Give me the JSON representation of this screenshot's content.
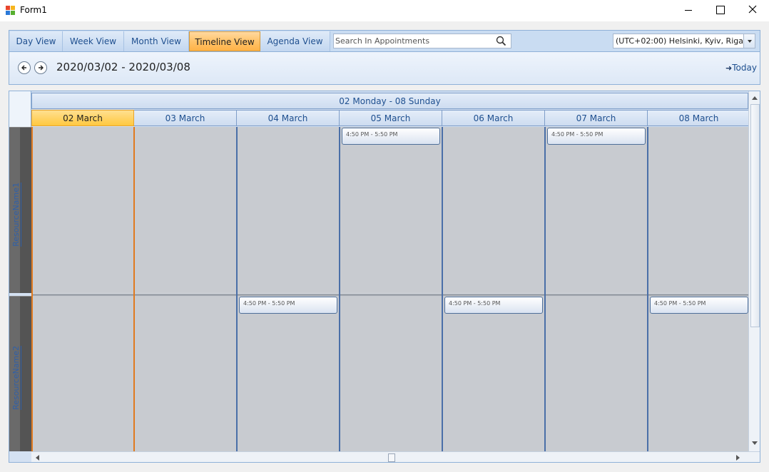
{
  "window": {
    "title": "Form1"
  },
  "tabs": [
    {
      "label": "Day View"
    },
    {
      "label": "Week View"
    },
    {
      "label": "Month View"
    },
    {
      "label": "Timeline View",
      "active": true
    },
    {
      "label": "Agenda View"
    }
  ],
  "search": {
    "placeholder": "Search In Appointments",
    "value": ""
  },
  "timezone": {
    "selected": "(UTC+02:00) Helsinki, Kyiv, Riga,"
  },
  "navigation": {
    "range": "2020/03/02 - 2020/03/08",
    "today_label": "Today"
  },
  "scheduler": {
    "week_header": "02 Monday - 08 Sunday",
    "days": [
      "02 March",
      "03 March",
      "04 March",
      "05 March",
      "06 March",
      "07 March",
      "08 March"
    ],
    "today_index": 0,
    "resources": [
      "ResourceName1",
      "ResourceName2"
    ],
    "appointments": [
      {
        "resource": 0,
        "day": 3,
        "time": "4:50 PM - 5:50 PM"
      },
      {
        "resource": 0,
        "day": 5,
        "time": "4:50 PM - 5:50 PM"
      },
      {
        "resource": 1,
        "day": 2,
        "time": "4:50 PM - 5:50 PM"
      },
      {
        "resource": 1,
        "day": 4,
        "time": "4:50 PM - 5:50 PM"
      },
      {
        "resource": 1,
        "day": 6,
        "time": "4:50 PM - 5:50 PM"
      }
    ]
  },
  "colors": {
    "today_accent": "#ffc840",
    "active_tab": "#ffb347",
    "cell": "#c8cbd0",
    "column_line": "#4a6fa8"
  }
}
